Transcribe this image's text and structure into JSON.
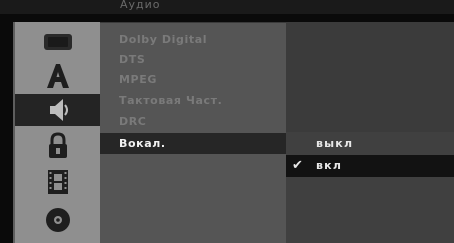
{
  "header": {
    "title": "Аудио"
  },
  "sidebar": {
    "items": [
      {
        "icon": "tv-screen-icon",
        "active": false
      },
      {
        "icon": "language-a-icon",
        "active": false
      },
      {
        "icon": "speaker-audio-icon",
        "active": true
      },
      {
        "icon": "padlock-icon",
        "active": false
      },
      {
        "icon": "film-strip-icon",
        "active": false
      },
      {
        "icon": "disc-icon",
        "active": false
      }
    ]
  },
  "menu": {
    "items": [
      {
        "label": "Dolby Digital"
      },
      {
        "label": "DTS"
      },
      {
        "label": "MPEG"
      },
      {
        "label": "Тактовая Част."
      },
      {
        "label": "DRC"
      },
      {
        "label": "Вокал."
      }
    ],
    "selected_index": 5
  },
  "values": {
    "options": [
      {
        "label": "выкл"
      },
      {
        "label": "вкл"
      }
    ],
    "checked_index": 1,
    "check_glyph": "✔"
  },
  "colors": {
    "icon_panel": "#8f8f8f",
    "option_panel": "#555555",
    "highlight": "#262626",
    "text_active": "#f2f2f2",
    "text_dim": "#7a7a7a"
  }
}
